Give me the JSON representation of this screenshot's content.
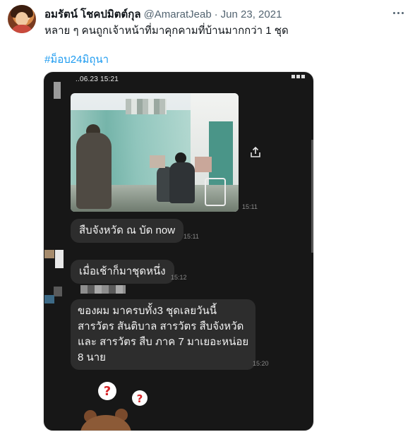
{
  "tweet": {
    "author_name": "อมรัตน์ โชคปมิตต์กุล",
    "handle": "@AmaratJeab",
    "separator": "·",
    "date": "Jun 23, 2021",
    "text": "หลาย ๆ คนถูกเจ้าหน้าที่มาคุกคามที่บ้านมากกว่า 1 ชุด",
    "hashtag": "#ม็อบ24มิถุนา"
  },
  "media": {
    "status_time": "..06.23 15:21",
    "photo_time": "15:11",
    "messages": [
      {
        "text": "สืบจังหวัด ณ บัด now",
        "time": "15:11"
      },
      {
        "text": "เมื่อเช้าก็มาชุดหนึ่ง",
        "time": "15:12"
      },
      {
        "lines": [
          "ของผม มาครบทั้ง3 ชุดเลยวันนี้",
          "สารวัตร สันติบาล สารวัตร สืบจังหวัด",
          "และ สารวัตร สืบ ภาค 7 มาเยอะหน่อย",
          "8 นาย"
        ],
        "time": "15:20"
      }
    ]
  },
  "colors": {
    "hashtag": "#1d9bf0",
    "text_primary": "#0f1419",
    "text_secondary": "#536471",
    "chat_background": "#171717",
    "bubble": "#2d2d2d"
  },
  "icons": [
    "more-icon",
    "share-icon",
    "question-sticker"
  ]
}
